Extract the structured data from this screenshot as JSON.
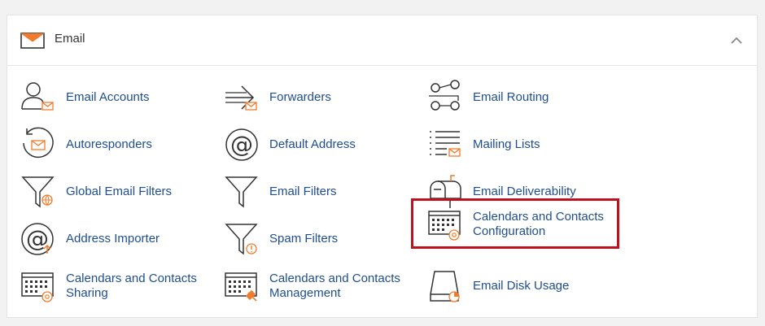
{
  "section": {
    "title": "Email",
    "accent_color": "#f17b2c",
    "link_color": "#1f4e8c",
    "highlight_color": "#c0101d"
  },
  "items": [
    {
      "label": "Email Accounts",
      "icon": "email-accounts-icon"
    },
    {
      "label": "Forwarders",
      "icon": "forwarders-icon"
    },
    {
      "label": "Email Routing",
      "icon": "email-routing-icon"
    },
    {
      "label": "Autoresponders",
      "icon": "autoresponders-icon"
    },
    {
      "label": "Default Address",
      "icon": "default-address-icon"
    },
    {
      "label": "Mailing Lists",
      "icon": "mailing-lists-icon"
    },
    {
      "label": "Global Email Filters",
      "icon": "global-email-filters-icon"
    },
    {
      "label": "Email Filters",
      "icon": "email-filters-icon"
    },
    {
      "label": "Email Deliverability",
      "icon": "email-deliverability-icon"
    },
    {
      "label": "Address Importer",
      "icon": "address-importer-icon"
    },
    {
      "label": "Spam Filters",
      "icon": "spam-filters-icon"
    },
    {
      "label": "Calendars and Contacts Configuration",
      "icon": "calendars-contacts-configuration-icon",
      "highlighted": true
    },
    {
      "label": "Calendars and Contacts Sharing",
      "icon": "calendars-contacts-sharing-icon"
    },
    {
      "label": "Calendars and Contacts Management",
      "icon": "calendars-contacts-management-icon"
    },
    {
      "label": "Email Disk Usage",
      "icon": "email-disk-usage-icon"
    }
  ]
}
